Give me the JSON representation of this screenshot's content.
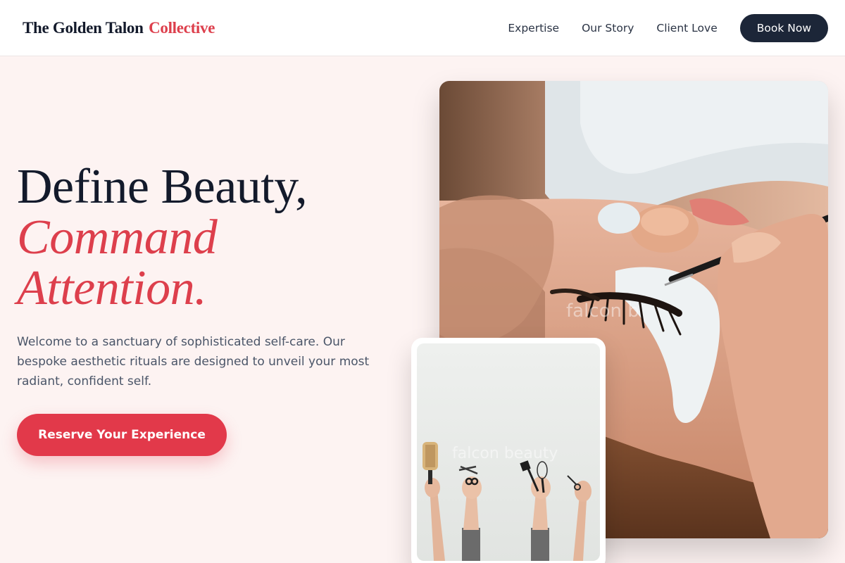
{
  "brand": {
    "name": "The Golden Talon",
    "accent": "Collective"
  },
  "nav": {
    "links": [
      "Expertise",
      "Our Story",
      "Client Love"
    ],
    "cta": "Book Now"
  },
  "hero": {
    "title_line1": "Define Beauty,",
    "title_line2": "Command",
    "title_line3": "Attention.",
    "subtitle": "Welcome to a sanctuary of sophisticated self-care. Our bespoke aesthetic rituals are designed to unveil your most radiant, confident self.",
    "cta": "Reserve Your Experience"
  },
  "images": {
    "main": {
      "subject": "eyelash-extension-treatment-photo",
      "watermark": "falcon b"
    },
    "secondary": {
      "subject": "raised-hands-holding-salon-tools-photo",
      "watermark": "falcon beauty"
    }
  },
  "colors": {
    "accent": "#dd3f4c",
    "dark": "#1c2638",
    "background": "#fdf3f2",
    "button": "#e2394a"
  }
}
